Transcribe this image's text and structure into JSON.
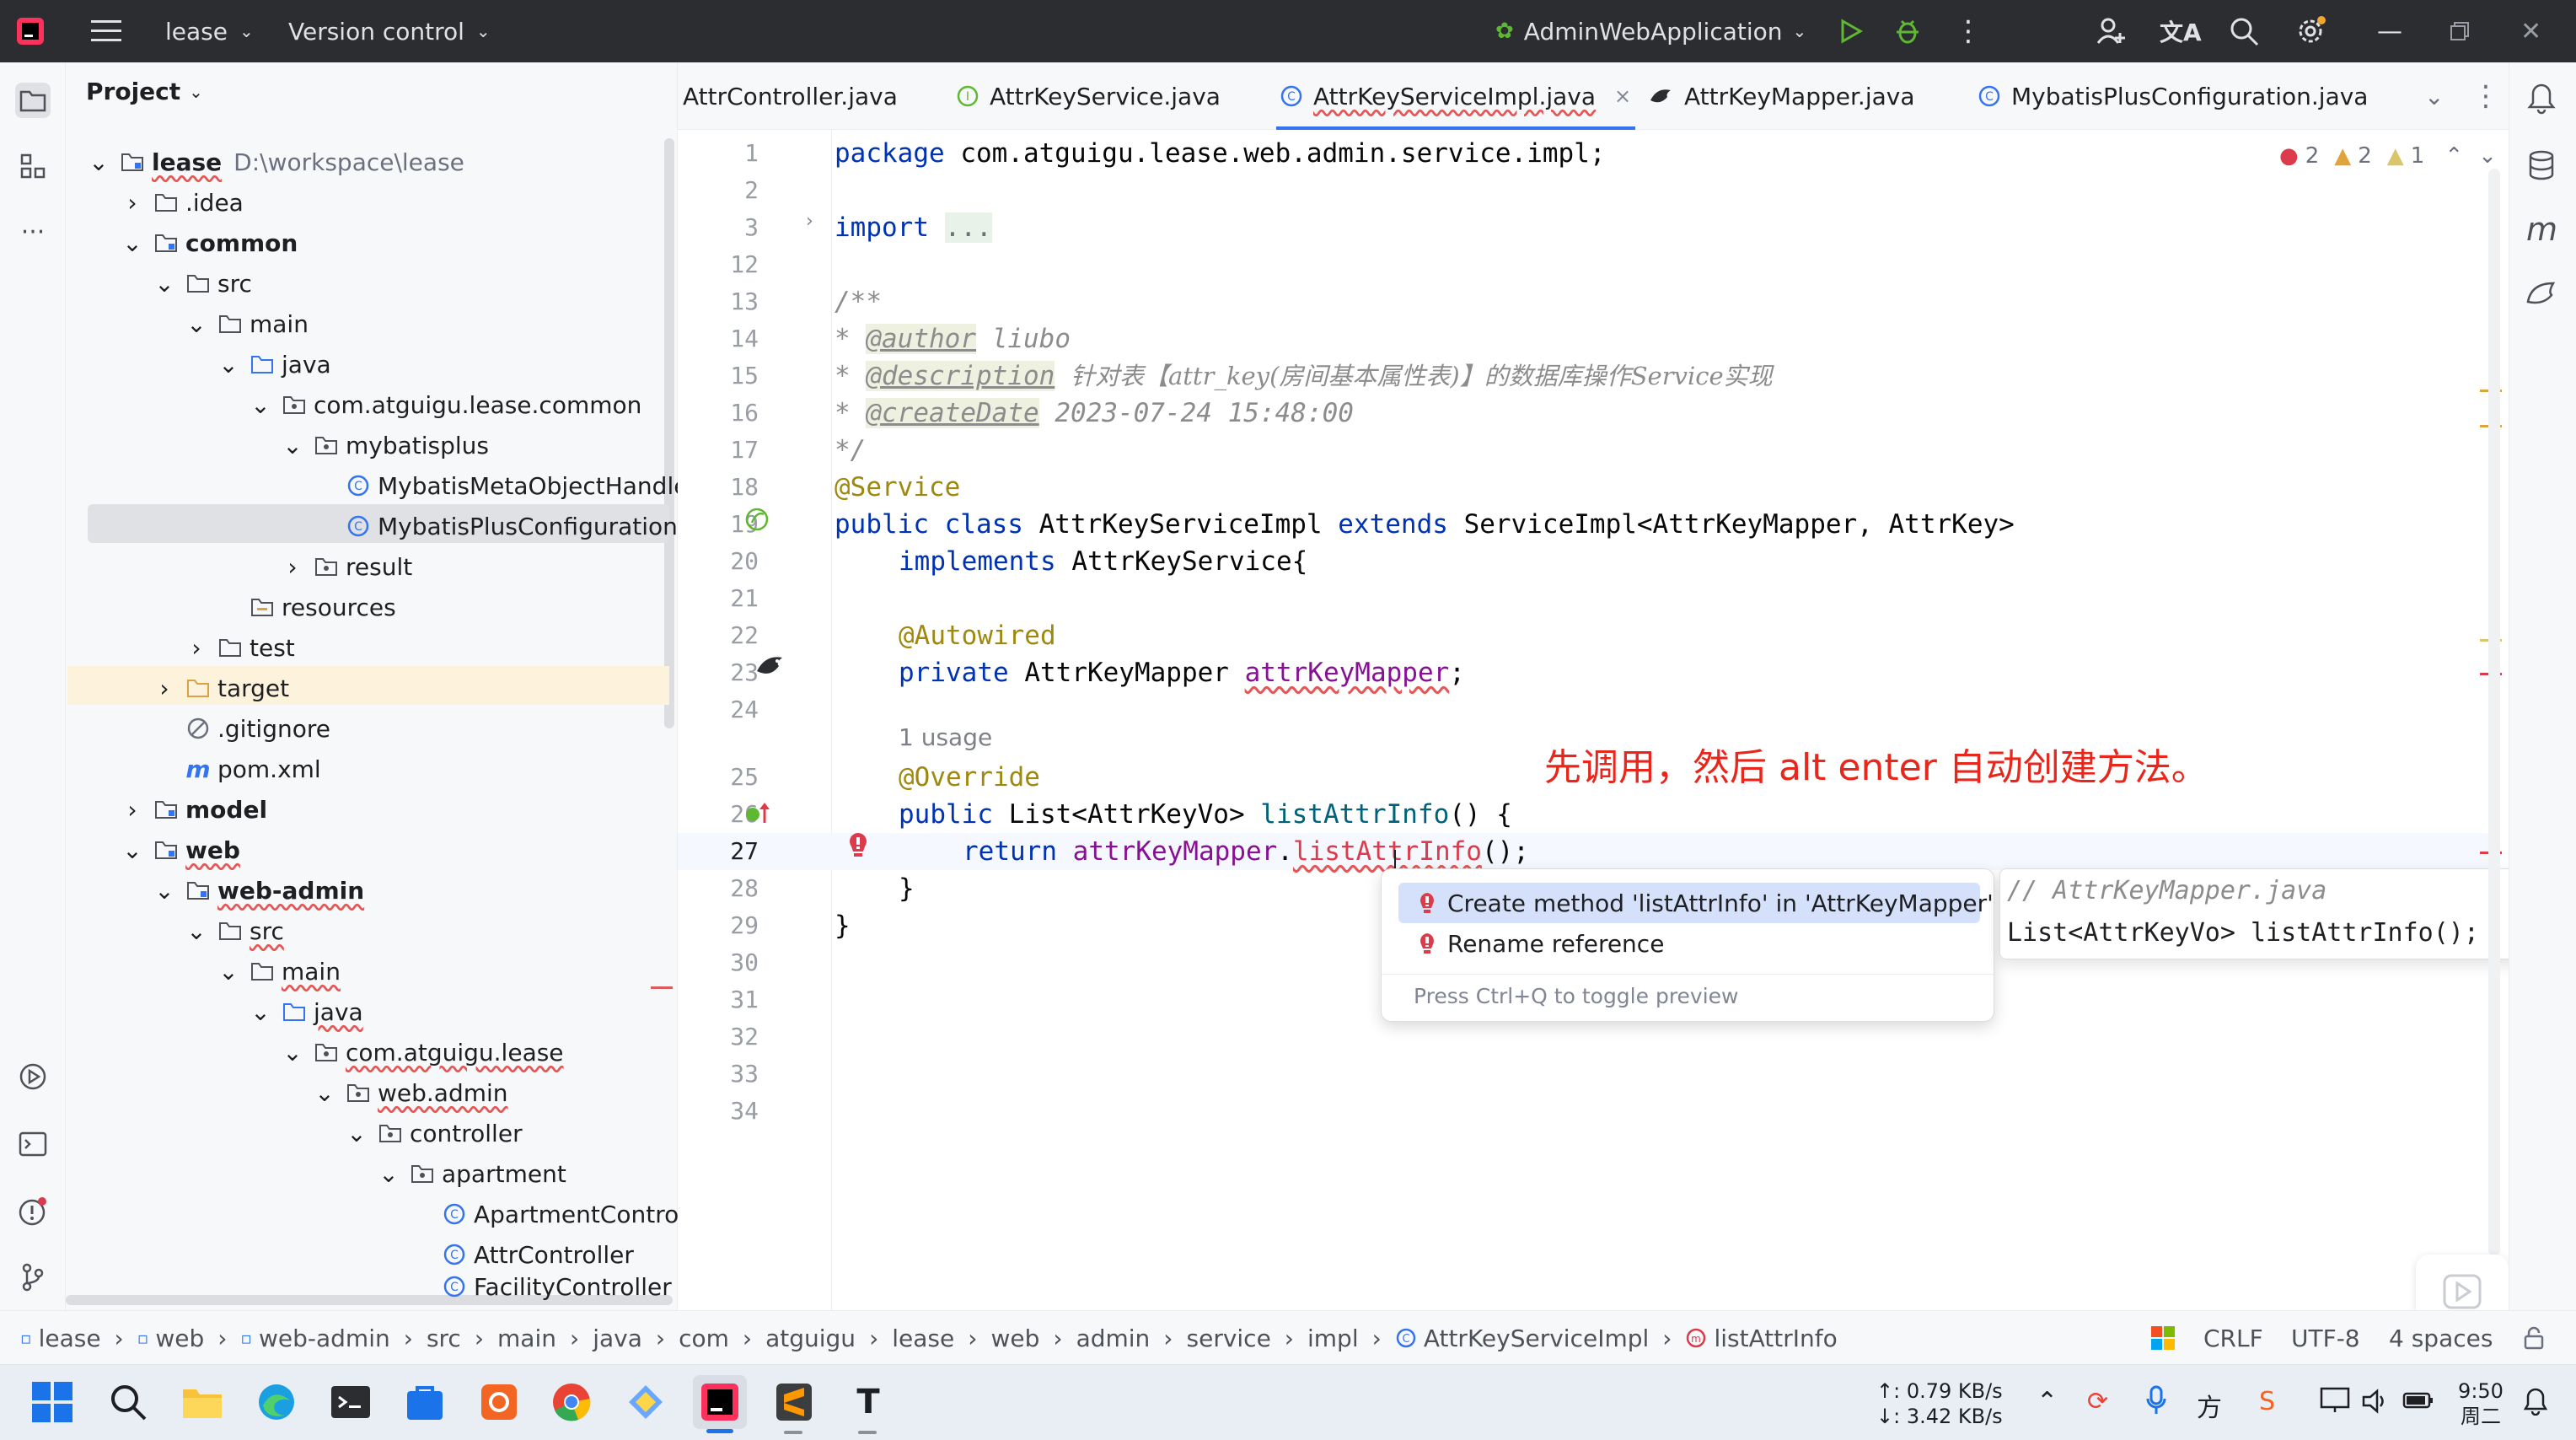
{
  "titlebar": {
    "project": "lease",
    "vcs": "Version control",
    "run_config": "AdminWebApplication"
  },
  "project_panel": {
    "title": "Project",
    "root_name": "lease",
    "root_path": "D:\\workspace\\lease",
    "nodes": [
      {
        "label": ".idea"
      },
      {
        "label": "common"
      },
      {
        "label": "src"
      },
      {
        "label": "main"
      },
      {
        "label": "java"
      },
      {
        "label": "com.atguigu.lease.common"
      },
      {
        "label": "mybatisplus"
      },
      {
        "label": "MybatisMetaObjectHandle"
      },
      {
        "label": "MybatisPlusConfiguration"
      },
      {
        "label": "result"
      },
      {
        "label": "resources"
      },
      {
        "label": "test"
      },
      {
        "label": "target"
      },
      {
        "label": ".gitignore"
      },
      {
        "label": "pom.xml"
      },
      {
        "label": "model"
      },
      {
        "label": "web"
      },
      {
        "label": "web-admin"
      },
      {
        "label": "src"
      },
      {
        "label": "main"
      },
      {
        "label": "java"
      },
      {
        "label": "com.atguigu.lease"
      },
      {
        "label": "web.admin"
      },
      {
        "label": "controller"
      },
      {
        "label": "apartment"
      },
      {
        "label": "ApartmentControll"
      },
      {
        "label": "AttrController"
      },
      {
        "label": "FacilityController"
      }
    ]
  },
  "tabs": [
    {
      "label": "AttrController.java"
    },
    {
      "label": "AttrKeyService.java"
    },
    {
      "label": "AttrKeyServiceImpl.java"
    },
    {
      "label": "AttrKeyMapper.java"
    },
    {
      "label": "MybatisPlusConfiguration.java"
    }
  ],
  "inspections": {
    "errors": "2",
    "warnings": "2",
    "weak": "1"
  },
  "editor": {
    "line_numbers": [
      "1",
      "2",
      "3",
      "12",
      "13",
      "14",
      "15",
      "16",
      "17",
      "18",
      "19",
      "20",
      "21",
      "22",
      "23",
      "24",
      "25",
      "26",
      "27",
      "28",
      "29",
      "30",
      "31",
      "32",
      "33",
      "34"
    ],
    "package_kw": "package",
    "package_name": "com.atguigu.lease.web.admin.service.impl;",
    "import_kw": "import",
    "import_fold": "...",
    "doc_open": "/**",
    "doc_star": "*",
    "author_tag": "@author",
    "author_val": "liubo",
    "desc_tag": "@description",
    "desc_val": "针对表【attr_key(房间基本属性表)】的数据库操作Service实现",
    "date_tag": "@createDate",
    "date_val": "2023-07-24 15:48:00",
    "doc_close": "*/",
    "service_ann": "@Service",
    "l19_kw": "public class",
    "l19_name": "AttrKeyServiceImpl",
    "l19_ext": "extends",
    "l19_rest": "ServiceImpl<AttrKeyMapper, AttrKey>",
    "l20_kw": "implements",
    "l20_rest": "AttrKeyService{",
    "autowired_ann": "@Autowired",
    "l23_kw": "private",
    "l23_type": "AttrKeyMapper",
    "l23_field": "attrKeyMapper",
    "l23_end": ";",
    "usage_hint": "1 usage",
    "override_ann": "@Override",
    "l26_kw": "public",
    "l26_rest": "List<AttrKeyVo>",
    "l26_method": "listAttrInfo",
    "l26_end": "() {",
    "l27_kw": "return",
    "l27_field": "attrKeyMapper",
    "l27_dot": ".",
    "l27_method": "listAttrInfo",
    "l27_end": "();",
    "l28": "}",
    "l29": "}"
  },
  "annotation_text": "先调用，然后 alt enter 自动创建方法。",
  "popup": {
    "items": [
      "Create method 'listAttrInfo' in 'AttrKeyMapper'",
      "Rename reference"
    ],
    "footer": "Press Ctrl+Q to toggle preview"
  },
  "preview": {
    "comment": "// AttrKeyMapper.java",
    "code": "List<AttrKeyVo> listAttrInfo();"
  },
  "breadcrumb": [
    "lease",
    "web",
    "web-admin",
    "src",
    "main",
    "java",
    "com",
    "atguigu",
    "lease",
    "web",
    "admin",
    "service",
    "impl",
    "AttrKeyServiceImpl",
    "listAttrInfo"
  ],
  "status": {
    "line_sep": "CRLF",
    "encoding": "UTF-8",
    "indent": "4 spaces"
  },
  "taskbar": {
    "net_up": "↑: 0.79 KB/s",
    "net_down": "↓: 3.42 KB/s",
    "time": "9:50",
    "day": "周二"
  },
  "colors": {
    "accent": "#3574f0",
    "error": "#db3b4b",
    "annotation_red": "#e8261b",
    "titlebar_bg": "#2b2d30"
  }
}
